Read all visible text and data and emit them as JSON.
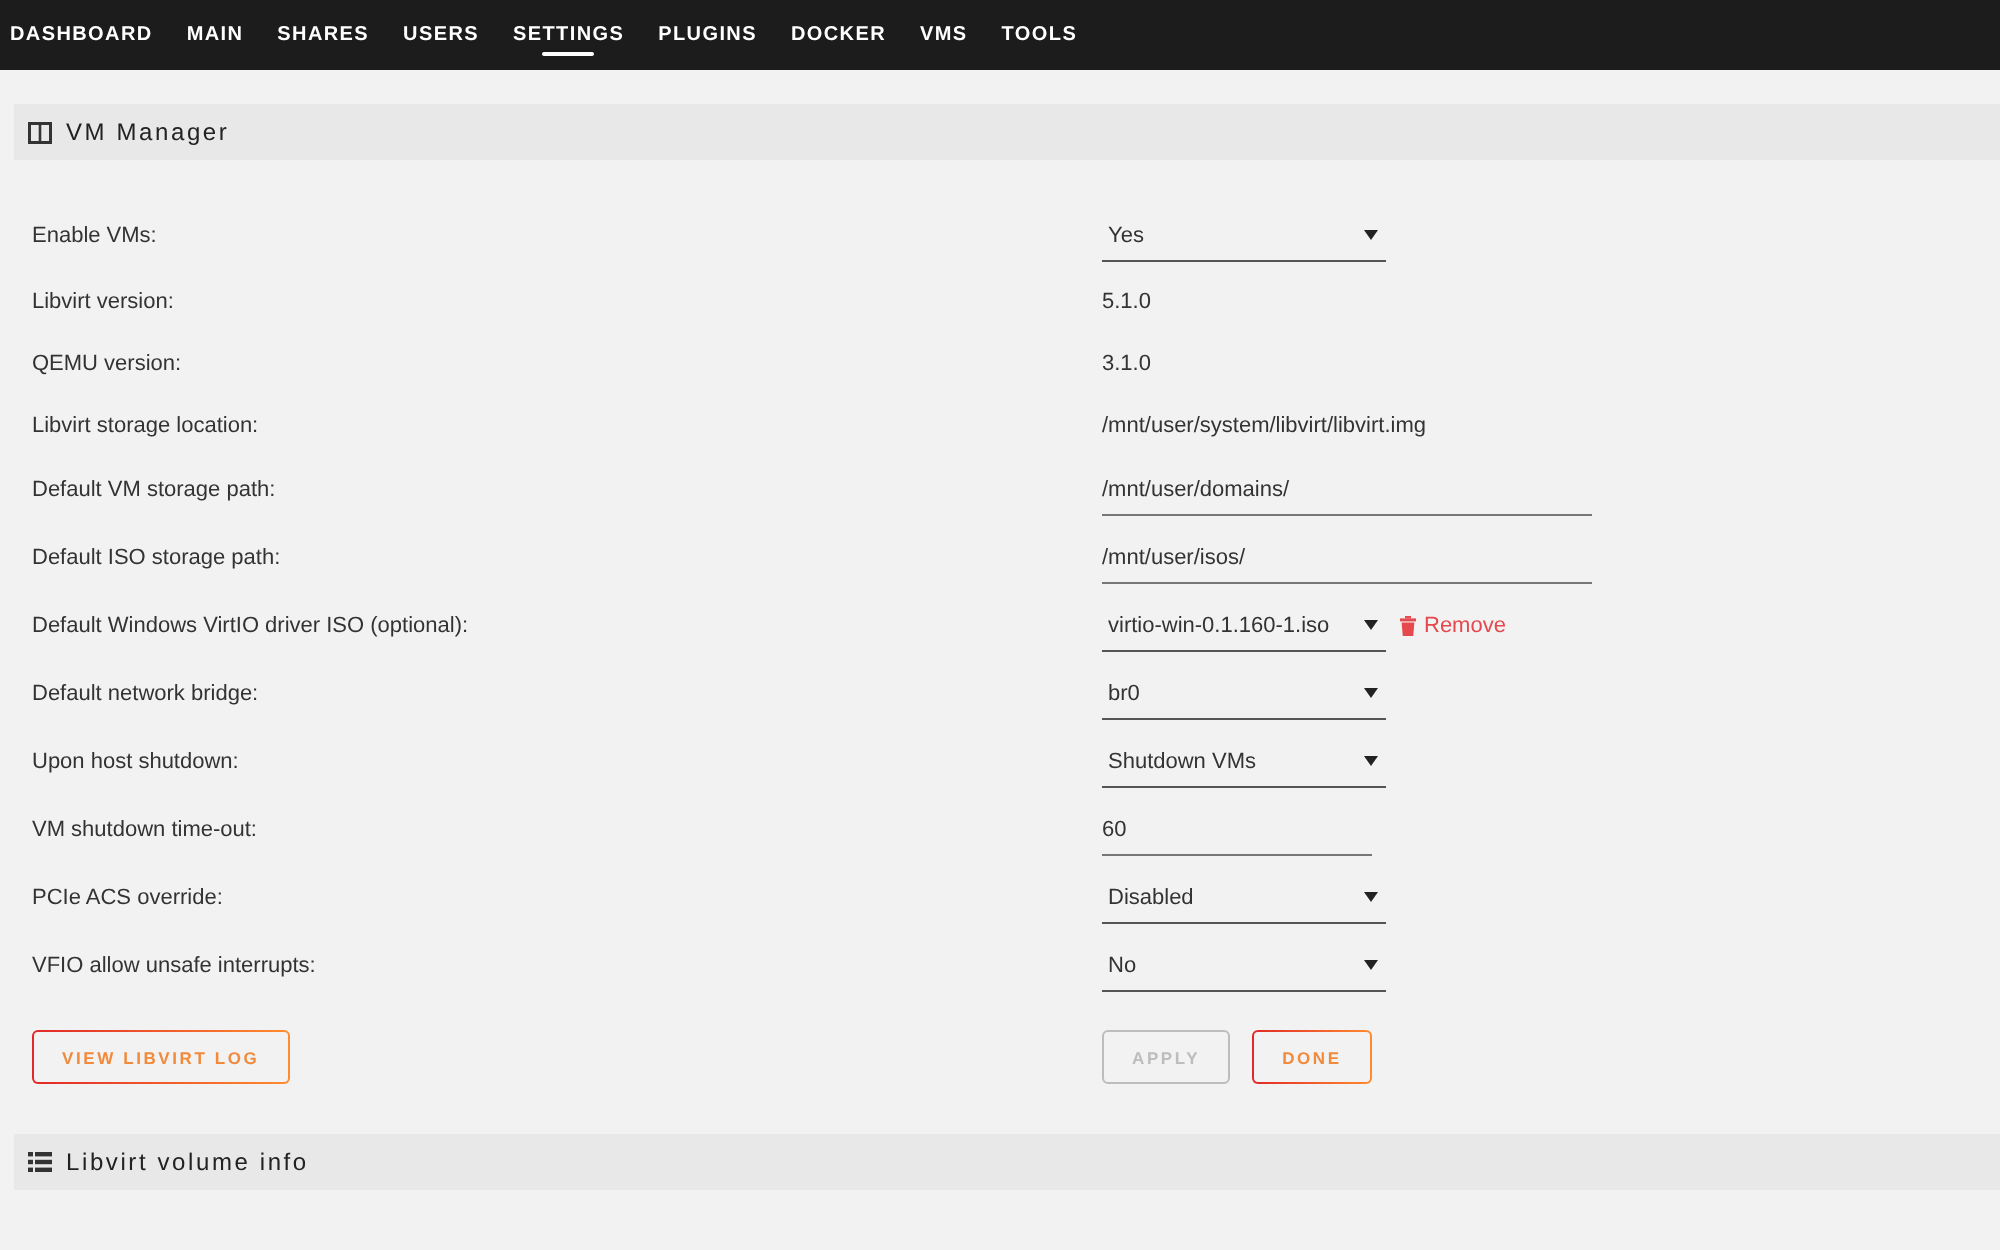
{
  "nav": {
    "tabs": [
      {
        "label": "DASHBOARD",
        "selected": false
      },
      {
        "label": "MAIN",
        "selected": false
      },
      {
        "label": "SHARES",
        "selected": false
      },
      {
        "label": "USERS",
        "selected": false
      },
      {
        "label": "SETTINGS",
        "selected": true
      },
      {
        "label": "PLUGINS",
        "selected": false
      },
      {
        "label": "DOCKER",
        "selected": false
      },
      {
        "label": "VMS",
        "selected": false
      },
      {
        "label": "TOOLS",
        "selected": false
      }
    ]
  },
  "vm_manager": {
    "title": "VM Manager",
    "settings": [
      {
        "label": "Enable VMs:",
        "kind": "select",
        "value": "Yes"
      },
      {
        "label": "Libvirt version:",
        "kind": "text",
        "value": "5.1.0"
      },
      {
        "label": "QEMU version:",
        "kind": "text",
        "value": "3.1.0"
      },
      {
        "label": "Libvirt storage location:",
        "kind": "text",
        "value": "/mnt/user/system/libvirt/libvirt.img"
      },
      {
        "label": "Default VM storage path:",
        "kind": "input",
        "value": "/mnt/user/domains/"
      },
      {
        "label": "Default ISO storage path:",
        "kind": "input",
        "value": "/mnt/user/isos/"
      },
      {
        "label": "Default Windows VirtIO driver ISO (optional):",
        "kind": "select",
        "value": "virtio-win-0.1.160-1.iso",
        "action": "Remove"
      },
      {
        "label": "Default network bridge:",
        "kind": "select",
        "value": "br0"
      },
      {
        "label": "Upon host shutdown:",
        "kind": "select",
        "value": "Shutdown VMs"
      },
      {
        "label": "VM shutdown time-out:",
        "kind": "number",
        "value": "60"
      },
      {
        "label": "PCIe ACS override:",
        "kind": "select",
        "value": "Disabled"
      },
      {
        "label": "VFIO allow unsafe interrupts:",
        "kind": "select",
        "value": "No"
      }
    ],
    "log_button": "VIEW LIBVIRT LOG",
    "buttons": [
      {
        "label": "APPLY",
        "disabled": true
      },
      {
        "label": "DONE",
        "disabled": false
      }
    ]
  },
  "volume_info": {
    "title": "Libvirt volume info"
  }
}
